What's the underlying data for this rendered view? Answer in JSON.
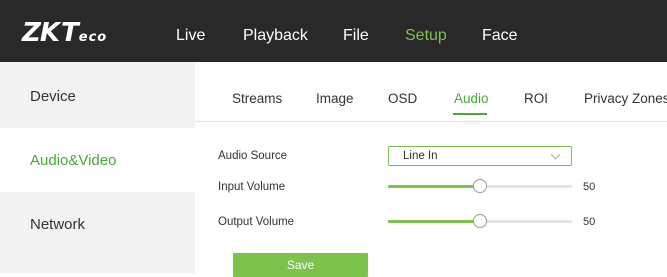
{
  "logo": {
    "zk": "ZK",
    "t": "T",
    "eco": "eco"
  },
  "nav": {
    "items": [
      {
        "label": "Live"
      },
      {
        "label": "Playback"
      },
      {
        "label": "File"
      },
      {
        "label": "Setup",
        "active": true
      },
      {
        "label": "Face"
      }
    ]
  },
  "sidebar": {
    "items": [
      {
        "label": "Device"
      },
      {
        "label": "Audio&Video",
        "active": true
      },
      {
        "label": "Network"
      }
    ]
  },
  "tabs": {
    "items": [
      {
        "label": "Streams"
      },
      {
        "label": "Image"
      },
      {
        "label": "OSD"
      },
      {
        "label": "Audio",
        "active": true
      },
      {
        "label": "ROI"
      },
      {
        "label": "Privacy Zones"
      }
    ]
  },
  "form": {
    "audio_source": {
      "label": "Audio Source",
      "value": "Line In"
    },
    "input_volume": {
      "label": "Input Volume",
      "value": 50,
      "value_text": "50",
      "max": 100
    },
    "output_volume": {
      "label": "Output Volume",
      "value": 50,
      "value_text": "50",
      "max": 100
    },
    "save_label": "Save"
  },
  "colors": {
    "topbar": "#292929",
    "accent": "#7dc24b",
    "accent_text": "#4aa83a",
    "sidebar_bg": "#f2f2f2"
  }
}
